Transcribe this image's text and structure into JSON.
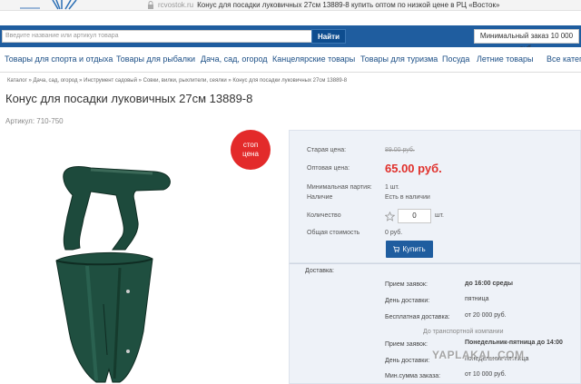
{
  "browser": {
    "domain": "rcvostok.ru",
    "page_title": "Конус для посадки луковичных 27см 13889-8 купить оптом по низкой цене в РЦ «Восток»"
  },
  "search": {
    "placeholder": "Введите название или артикул товара",
    "button_label": "Найти",
    "min_order": "Минимальный заказ 10 000 руб."
  },
  "nav": {
    "items": [
      "Товары для спорта и отдыха",
      "Товары для рыбалки",
      "Дача, сад, огород",
      "Канцелярские товары",
      "Товары для туризма",
      "Посуда",
      "Летние товары",
      "Все катего"
    ]
  },
  "breadcrumb": "Каталог » Дача, сад, огород » Инструмент садовый » Совки, вилки, рыхлители, сеялки » Конус для посадки луковичных 27см 13889-8",
  "product": {
    "title": "Конус для посадки луковичных 27см 13889-8",
    "article": "Артикул: 710-750",
    "badge_line1": "стоп",
    "badge_line2": "цена"
  },
  "price_panel": {
    "old_price_label": "Старая цена:",
    "old_price": "89.00 руб.",
    "wholesale_label": "Оптовая цена:",
    "wholesale_price": "65.00 руб.",
    "min_batch_label": "Минимальная партия:",
    "min_batch": "1 шт.",
    "availability_label": "Наличие",
    "availability": "Есть в наличии",
    "quantity_label": "Количество",
    "quantity": "0",
    "quantity_unit": "шт.",
    "total_label": "Общая стоимость",
    "total": "0 руб.",
    "buy_label": "Купить"
  },
  "delivery": {
    "title": "Доставка:",
    "order_intake_label": "Прием заявок:",
    "order_intake": "до 16:00 среды",
    "delivery_day_label": "День доставки:",
    "delivery_day": "пятница",
    "free_delivery_label": "Бесплатная доставка:",
    "free_delivery": "от 20 000 руб.",
    "transport_note": "До транспортной компании",
    "tc_order_intake_label": "Прием заявок:",
    "tc_order_intake": "Понедельник-пятница до 14:00",
    "tc_delivery_day_label": "День доставки:",
    "tc_delivery_day": "понедельник-пятница",
    "tc_min_sum_label": "Мин.сумма заказа:",
    "tc_min_sum": "от 10 000 руб."
  },
  "watermark": "YAPLAKAL.COM",
  "colors": {
    "brand_blue": "#1f5d9f",
    "price_red": "#e0302b",
    "badge_red": "#e32a2a",
    "panel_bg": "#eef2f8"
  }
}
